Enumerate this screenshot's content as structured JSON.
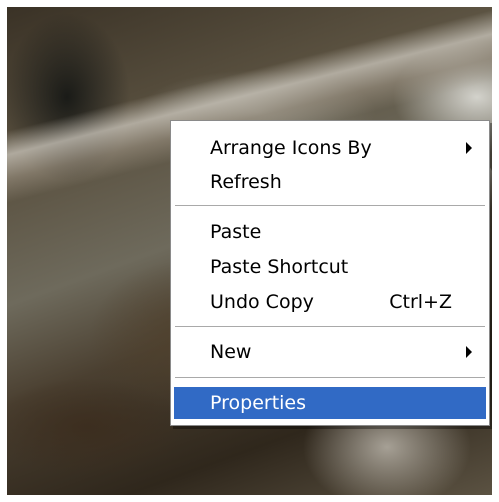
{
  "context_menu": {
    "items": [
      {
        "label": "Arrange Icons By",
        "submenu": true
      },
      {
        "label": "Refresh"
      },
      {
        "label": "Paste"
      },
      {
        "label": "Paste Shortcut"
      },
      {
        "label": "Undo Copy",
        "shortcut": "Ctrl+Z"
      },
      {
        "label": "New",
        "submenu": true
      },
      {
        "label": "Properties",
        "selected": true
      }
    ],
    "icons": {
      "submenu": "submenu-arrow-icon"
    },
    "colors": {
      "selection_background": "#316ac5",
      "selection_text": "#ffffff",
      "menu_background": "#ffffff",
      "separator": "#a9a9a9"
    }
  }
}
